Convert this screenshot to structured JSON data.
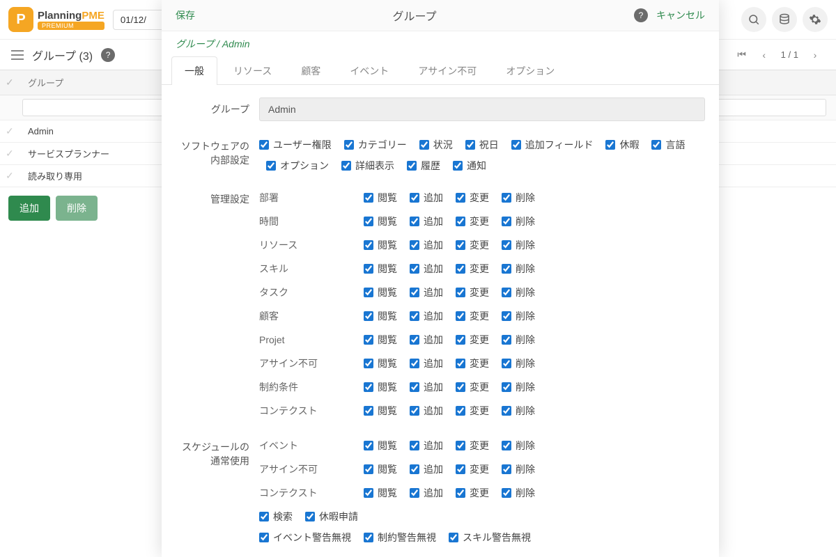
{
  "app": {
    "name": "Planning",
    "suffix": "PME",
    "badge": "PREMIUM"
  },
  "date": "01/12/",
  "toolbar": {
    "title": "グループ (3)"
  },
  "pager": {
    "current": "1",
    "sep": "/",
    "total": "1"
  },
  "list": {
    "header": "グループ",
    "rows": [
      "Admin",
      "サービスプランナー",
      "読み取り専用"
    ]
  },
  "buttons": {
    "add": "追加",
    "del": "削除"
  },
  "modal": {
    "save": "保存",
    "title": "グループ",
    "cancel": "キャンセル",
    "crumb": "グループ / Admin",
    "tabs": [
      "一般",
      "リソース",
      "顧客",
      "イベント",
      "アサイン不可",
      "オプション"
    ],
    "groupLabel": "グループ",
    "groupValue": "Admin",
    "sections": {
      "software": {
        "label": "ソフトウェアの内部設定",
        "items1": [
          "ユーザー権限",
          "カテゴリー",
          "状況",
          "祝日",
          "追加フィールド",
          "休暇",
          "言語"
        ],
        "items2": [
          "オプション",
          "詳細表示",
          "履歴",
          "通知"
        ]
      },
      "admin": {
        "label": "管理設定",
        "cols": [
          "閲覧",
          "追加",
          "変更",
          "削除"
        ],
        "rows": [
          "部署",
          "時間",
          "リソース",
          "スキル",
          "タスク",
          "顧客",
          "Projet",
          "アサイン不可",
          "制約条件",
          "コンテクスト"
        ]
      },
      "schedule": {
        "label": "スケジュールの通常使用",
        "cols": [
          "閲覧",
          "追加",
          "変更",
          "削除"
        ],
        "rows": [
          "イベント",
          "アサイン不可",
          "コンテクスト"
        ],
        "extra1": [
          "検索",
          "休暇申請"
        ],
        "extra2": [
          "イベント警告無視",
          "制約警告無視",
          "スキル警告無視"
        ]
      }
    }
  }
}
